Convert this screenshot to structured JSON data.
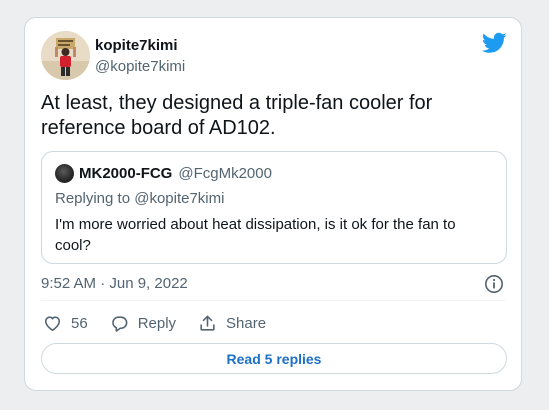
{
  "tweet": {
    "author": {
      "name": "kopite7kimi",
      "handle": "@kopite7kimi"
    },
    "text": "At least, they designed a triple-fan cooler for reference board of AD102.",
    "timestamp": "9:52 AM · Jun 9, 2022",
    "likes": "56",
    "reply_label": "Reply",
    "share_label": "Share",
    "read_replies_label": "Read 5 replies"
  },
  "quoted_tweet": {
    "author": {
      "name": "MK2000-FCG",
      "handle": "@FcgMk2000"
    },
    "replying_to": "Replying to @kopite7kimi",
    "text": "I'm more worried about heat dissipation, is it ok for the fan to cool?"
  },
  "icons": {
    "brand": "twitter-bird-icon",
    "info": "info-icon",
    "like": "heart-icon",
    "reply": "reply-bubble-icon",
    "share": "share-upload-icon"
  },
  "colors": {
    "brand_blue": "#1d9bf0",
    "link_blue": "#1d70c8",
    "text_primary": "#0f1419",
    "text_secondary": "#536471",
    "border": "#cfd9de",
    "background": "#eceef0"
  }
}
